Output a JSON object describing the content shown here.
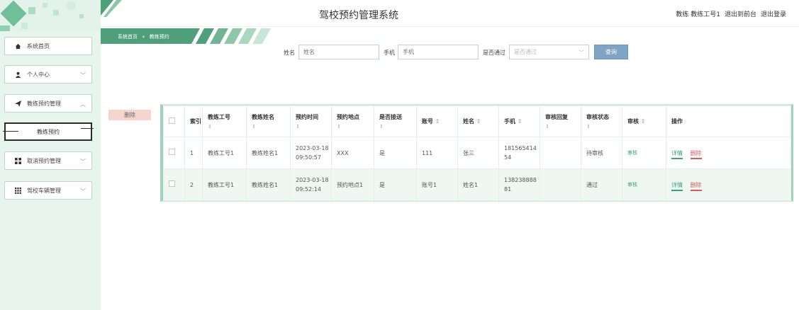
{
  "app": {
    "title": "驾校预约管理系统"
  },
  "topbar": {
    "user_label": "教练 教练工号1",
    "to_front": "退出到前台",
    "logout": "退出登录"
  },
  "breadcrumb": {
    "home": "系统首页",
    "sep": "»",
    "current": "教练预约"
  },
  "sidebar": {
    "items": [
      {
        "label": "系统首页",
        "icon": "home-icon"
      },
      {
        "label": "个人中心",
        "icon": "user-icon"
      },
      {
        "label": "教练预约管理",
        "icon": "send-icon"
      },
      {
        "label": "教练预约",
        "icon": "none"
      },
      {
        "label": "取消预约管理",
        "icon": "grid-icon"
      },
      {
        "label": "驾校车辆管理",
        "icon": "apps-icon"
      }
    ]
  },
  "search": {
    "name_label": "姓名",
    "name_placeholder": "姓名",
    "phone_label": "手机",
    "phone_placeholder": "手机",
    "pass_label": "是否通过",
    "pass_placeholder": "是否通过",
    "query_label": "查询"
  },
  "actions": {
    "delete_label": "删除"
  },
  "table": {
    "headers": [
      "索引",
      "教练工号",
      "教练姓名",
      "预约时间",
      "预约地点",
      "是否接送",
      "账号",
      "姓名",
      "手机",
      "审核回复",
      "审核状态",
      "审核",
      "操作"
    ],
    "rows": [
      {
        "index": "1",
        "coach_id": "教练工号1",
        "coach_name": "教练姓名1",
        "time": "2023-03-18 09:50:57",
        "place": "XXX",
        "pickup": "是",
        "account": "111",
        "name": "张三",
        "phone": "18156541454",
        "reply": "",
        "status": "待审核",
        "review": "审核",
        "detail": "详情",
        "delete": "删除"
      },
      {
        "index": "2",
        "coach_id": "教练工号1",
        "coach_name": "教练姓名1",
        "time": "2023-03-18 09:52:14",
        "place": "预约地点1",
        "pickup": "是",
        "account": "账号1",
        "name": "姓名1",
        "phone": "13823888881",
        "reply": "",
        "status": "通过",
        "review": "审核",
        "detail": "详情",
        "delete": "删除"
      }
    ]
  },
  "colors": {
    "accent": "#3aa178",
    "sidebar_bg": "#e8f4ee",
    "query_btn": "#7fa4c4",
    "delete_btn": "#f7d5cf"
  }
}
